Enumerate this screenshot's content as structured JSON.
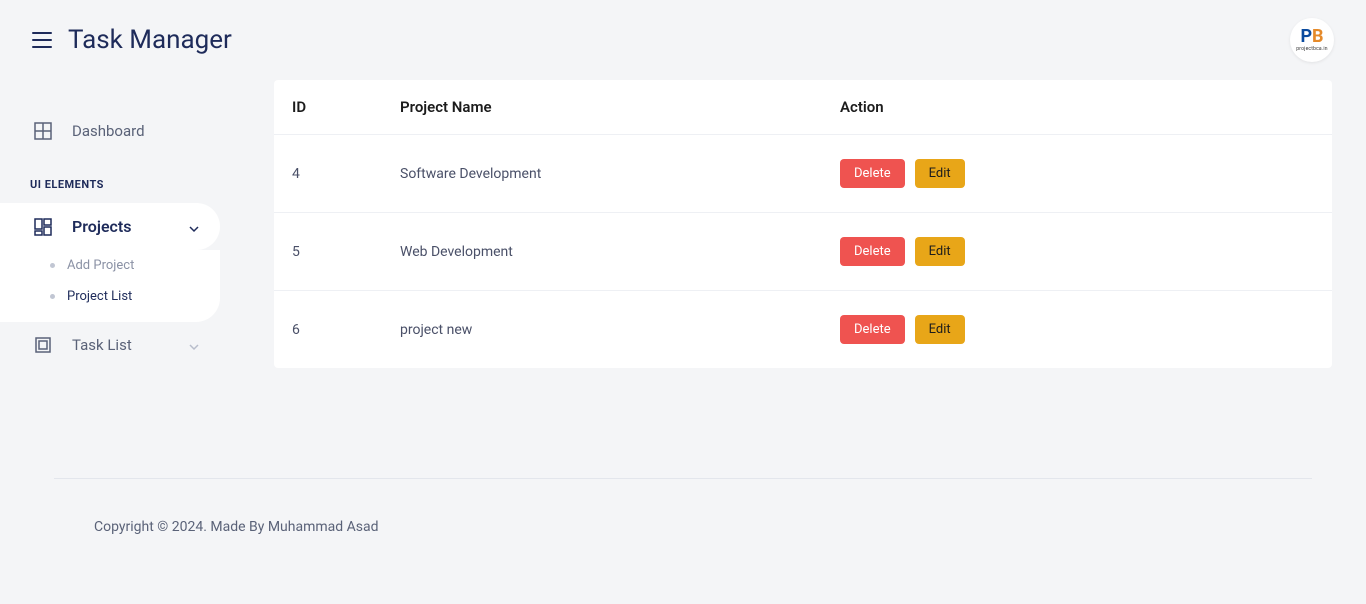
{
  "header": {
    "title": "Task Manager",
    "logo_p": "P",
    "logo_b": "B",
    "logo_sub": "projectbca.in"
  },
  "sidebar": {
    "dashboard": "Dashboard",
    "section_label": "UI ELEMENTS",
    "projects": "Projects",
    "add_project": "Add Project",
    "project_list": "Project List",
    "task_list": "Task List"
  },
  "table": {
    "headers": {
      "id": "ID",
      "name": "Project Name",
      "action": "Action"
    },
    "rows": [
      {
        "id": "4",
        "name": "Software Development"
      },
      {
        "id": "5",
        "name": "Web Development"
      },
      {
        "id": "6",
        "name": "project new"
      }
    ],
    "buttons": {
      "delete": "Delete",
      "edit": "Edit"
    }
  },
  "footer": "Copyright © 2024. Made By Muhammad Asad"
}
